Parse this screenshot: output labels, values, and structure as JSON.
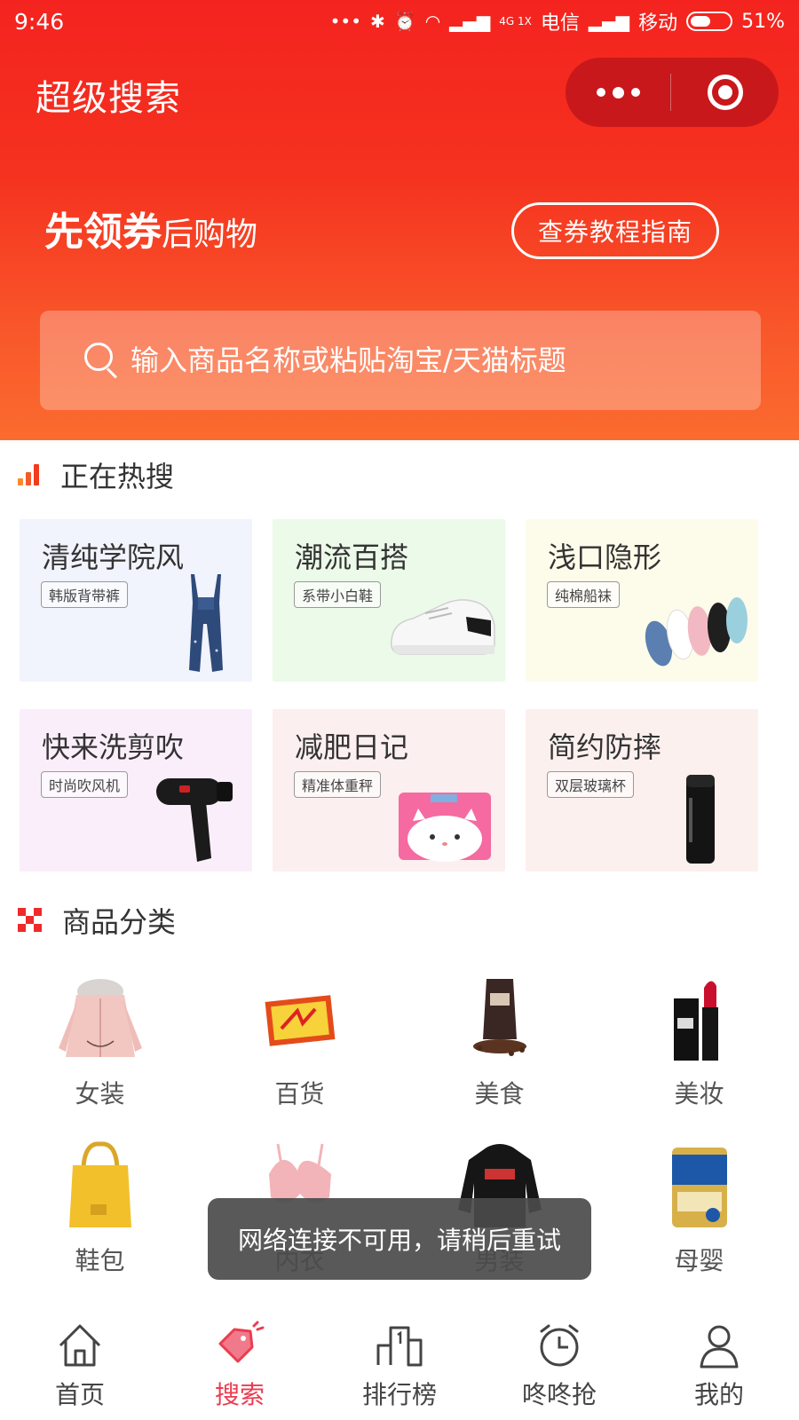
{
  "status_bar": {
    "time": "9:46",
    "network1": "4G 1X",
    "carrier1": "电信",
    "carrier2": "移动",
    "battery": "51%"
  },
  "header": {
    "title": "超级搜索",
    "slogan_strong": "先领券",
    "slogan_light": "后购物",
    "guide_button": "查券教程指南",
    "search_placeholder": "输入商品名称或粘贴淘宝/天猫标题",
    "colors": {
      "gradient_top": "#f4231f",
      "gradient_bottom": "#fb6b2f",
      "capsule": "#c8181b"
    }
  },
  "hot_search": {
    "title": "正在热搜",
    "cards": [
      {
        "title": "清纯学院风",
        "tag": "韩版背带裤",
        "bg": "#f1f3fd",
        "icon": "overalls-icon"
      },
      {
        "title": "潮流百搭",
        "tag": "系带小白鞋",
        "bg": "#ecfae9",
        "icon": "sneaker-icon"
      },
      {
        "title": "浅口隐形",
        "tag": "纯棉船袜",
        "bg": "#fdfbea",
        "icon": "socks-icon"
      },
      {
        "title": "快来洗剪吹",
        "tag": "时尚吹风机",
        "bg": "#fbeefb",
        "icon": "hair-dryer-icon"
      },
      {
        "title": "减肥日记",
        "tag": "精准体重秤",
        "bg": "#fcefef",
        "icon": "scale-icon"
      },
      {
        "title": "简约防摔",
        "tag": "双层玻璃杯",
        "bg": "#fcf0ee",
        "icon": "bottle-icon"
      }
    ]
  },
  "categories": {
    "title": "商品分类",
    "items": [
      {
        "label": "女装",
        "icon": "jacket-icon"
      },
      {
        "label": "百货",
        "icon": "heat-pack-icon"
      },
      {
        "label": "美食",
        "icon": "coffee-bag-icon"
      },
      {
        "label": "美妆",
        "icon": "lipstick-icon"
      },
      {
        "label": "鞋包",
        "icon": "tote-bag-icon"
      },
      {
        "label": "内衣",
        "icon": "bra-icon"
      },
      {
        "label": "男装",
        "icon": "hoodie-icon"
      },
      {
        "label": "母婴",
        "icon": "milk-powder-icon"
      }
    ]
  },
  "toast": {
    "message": "网络连接不可用，请稍后重试"
  },
  "tabbar": {
    "active_color": "#ec3c4f",
    "tabs": [
      {
        "label": "首页",
        "icon": "home-icon",
        "active": false
      },
      {
        "label": "搜索",
        "icon": "tag-icon",
        "active": true
      },
      {
        "label": "排行榜",
        "icon": "podium-icon",
        "active": false
      },
      {
        "label": "咚咚抢",
        "icon": "alarm-clock-icon",
        "active": false
      },
      {
        "label": "我的",
        "icon": "user-icon",
        "active": false
      }
    ]
  }
}
